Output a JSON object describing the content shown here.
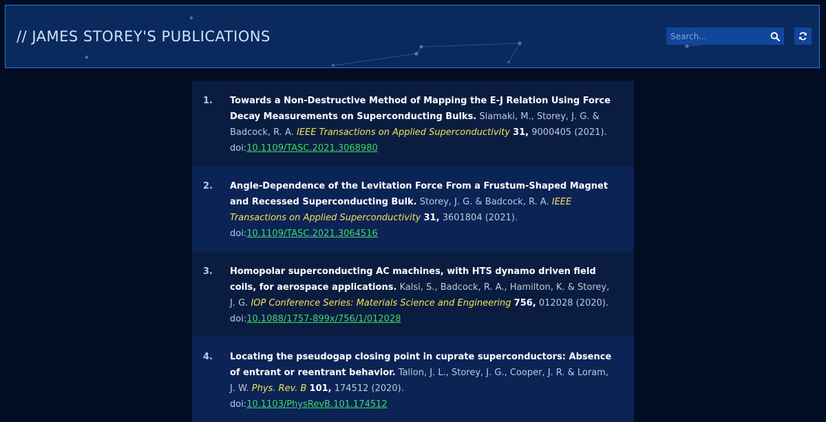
{
  "header": {
    "title": "// JAMES STOREY'S PUBLICATIONS",
    "search_placeholder": "Search...",
    "search_icon": "search-icon",
    "refresh_icon": "refresh-icon"
  },
  "colors": {
    "header_bg": "#0a2a5e",
    "header_border": "#2a78d8",
    "page_bg": "#020d24",
    "journal": "#f2e35a",
    "doi_link": "#3ed96b",
    "title": "#ffffff"
  },
  "publications": [
    {
      "number": "1.",
      "title": "Towards a Non-Destructive Method of Mapping the E-J Relation Using Force Decay Measurements on Superconducting Bulks.",
      "authors": "Slamaki, M., Storey, J. G. & Badcock, R. A.",
      "journal": "IEEE Transactions on Applied Superconductivity",
      "volume": "31,",
      "pages_year": "9000405 (2021).",
      "doi_label": "doi:",
      "doi": "10.1109/TASC.2021.3068980"
    },
    {
      "number": "2.",
      "title": "Angle-Dependence of the Levitation Force From a Frustum-Shaped Magnet and Recessed Superconducting Bulk.",
      "authors": "Storey, J. G. & Badcock, R. A.",
      "journal": "IEEE Transactions on Applied Superconductivity",
      "volume": "31,",
      "pages_year": "3601804 (2021).",
      "doi_label": "doi:",
      "doi": "10.1109/TASC.2021.3064516"
    },
    {
      "number": "3.",
      "title": "Homopolar superconducting AC machines, with HTS dynamo driven field coils, for aerospace applications.",
      "authors": "Kalsi, S., Badcock, R. A., Hamilton, K. & Storey, J. G.",
      "journal": "IOP Conference Series: Materials Science and Engineering",
      "volume": "756,",
      "pages_year": "012028 (2020).",
      "doi_label": "doi:",
      "doi": "10.1088/1757-899x/756/1/012028"
    },
    {
      "number": "4.",
      "title": "Locating the pseudogap closing point in cuprate superconductors: Absence of entrant or reentrant behavior.",
      "authors": "Tallon, J. L., Storey, J. G., Cooper, J. R. & Loram, J. W.",
      "journal": "Phys. Rev. B",
      "volume": "101,",
      "pages_year": "174512 (2020).",
      "doi_label": "doi:",
      "doi": "10.1103/PhysRevB.101.174512"
    }
  ]
}
